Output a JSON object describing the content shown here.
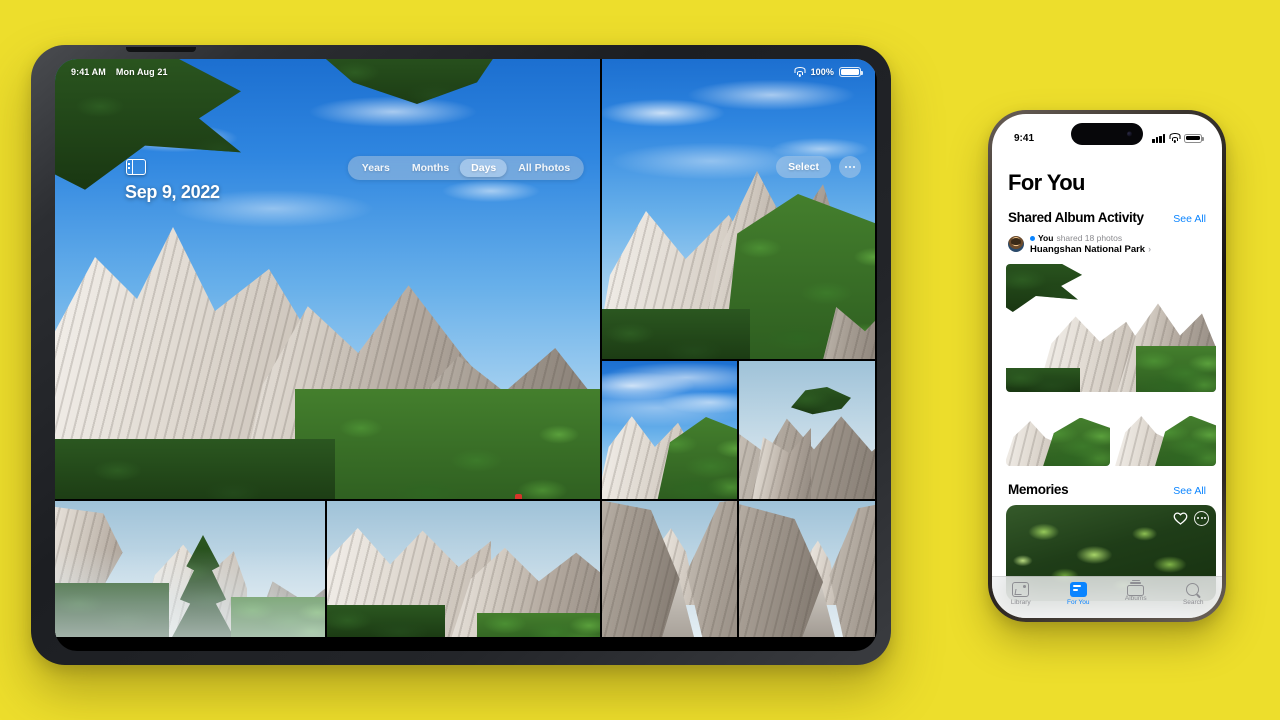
{
  "background_color": "#EDDE2C",
  "ipad": {
    "status_bar": {
      "time": "9:41 AM",
      "date": "Mon Aug 21",
      "wifi_icon": "wifi-icon",
      "battery_percent": "100%",
      "battery_icon": "battery-icon"
    },
    "sidebar_toggle_icon": "sidebar-toggle-icon",
    "date_title": "Sep 9, 2022",
    "segmented_control": {
      "options": [
        "Years",
        "Months",
        "Days",
        "All Photos"
      ],
      "selected": "Days"
    },
    "actions": {
      "select_label": "Select",
      "more_icon": "ellipsis-icon"
    },
    "photo_grid": {
      "cells": [
        {
          "name": "hero-photo",
          "caption": "Huangshan granite peaks with pine branches and blue sky"
        },
        {
          "name": "top-right-photo",
          "caption": "Rocky ridge with green pine forest"
        },
        {
          "name": "mid-left-photo",
          "caption": "Mountain peak above pine slope"
        },
        {
          "name": "mid-right-photo",
          "caption": "Close granite boulders in mist"
        },
        {
          "name": "bottom-photo-1",
          "caption": "Pine trees on cliff edge, hazy valley"
        },
        {
          "name": "bottom-photo-2",
          "caption": "Jagged rock wall in daylight"
        },
        {
          "name": "bottom-photo-3",
          "caption": "Stone stairway between rock gorge"
        },
        {
          "name": "bottom-photo-4",
          "caption": "Stone stairway between rock gorge, wider view"
        }
      ]
    }
  },
  "iphone": {
    "status_bar": {
      "time": "9:41",
      "cellular_icon": "cellular-bars-icon",
      "wifi_icon": "wifi-icon",
      "battery_icon": "battery-icon"
    },
    "page_title": "For You",
    "shared_album": {
      "heading": "Shared Album Activity",
      "see_all": "See All",
      "avatar": "user-avatar",
      "actor": "You",
      "activity": "shared 18 photos",
      "album_name": "Huangshan National Park",
      "chevron": "›"
    },
    "memories": {
      "heading": "Memories",
      "see_all": "See All",
      "favorite_icon": "heart-icon",
      "more_icon": "ellipsis-circle-icon"
    },
    "tab_bar": {
      "tabs": [
        {
          "label": "Library",
          "icon": "photo-library-icon",
          "active": false
        },
        {
          "label": "For You",
          "icon": "for-you-icon",
          "active": true
        },
        {
          "label": "Albums",
          "icon": "albums-icon",
          "active": false
        },
        {
          "label": "Search",
          "icon": "search-icon",
          "active": false
        }
      ]
    }
  }
}
